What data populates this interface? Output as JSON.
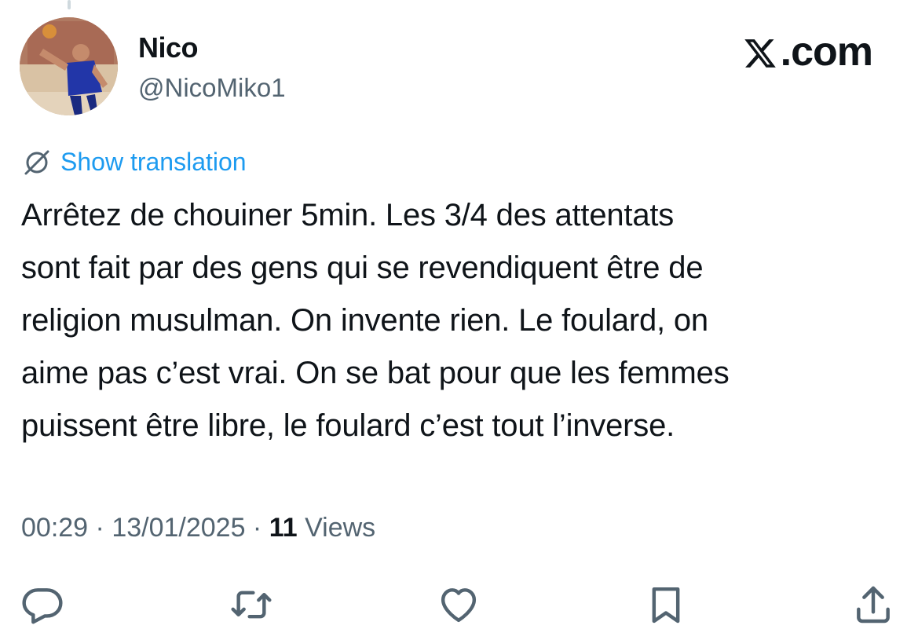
{
  "author": {
    "display_name": "Nico",
    "handle": "@NicoMiko1"
  },
  "brand": {
    "label": ".com",
    "icon": "x-logo-icon"
  },
  "translation": {
    "label": "Show translation",
    "icon": "globe-slash-icon",
    "color": "#1d9bf0"
  },
  "tweet": {
    "lines": [
      "Arrêtez de chouiner 5min. Les 3/4 des attentats",
      "sont fait par des gens qui se revendiquent être de",
      "religion musulman. On invente rien. Le foulard, on",
      "aime pas c’est vrai. On se bat pour que les femmes",
      "puissent être libre, le foulard c’est tout l’inverse."
    ]
  },
  "meta": {
    "time": "00:29",
    "separator": " · ",
    "date": "13/01/2025",
    "views_count": "11",
    "views_label": " Views"
  },
  "actions": [
    {
      "name": "reply-button",
      "icon": "reply-icon"
    },
    {
      "name": "retweet-button",
      "icon": "retweet-icon"
    },
    {
      "name": "like-button",
      "icon": "heart-icon"
    },
    {
      "name": "bookmark-button",
      "icon": "bookmark-icon"
    },
    {
      "name": "share-button",
      "icon": "share-icon"
    }
  ],
  "colors": {
    "text": "#0f1419",
    "secondary": "#536471",
    "accent": "#1d9bf0"
  }
}
